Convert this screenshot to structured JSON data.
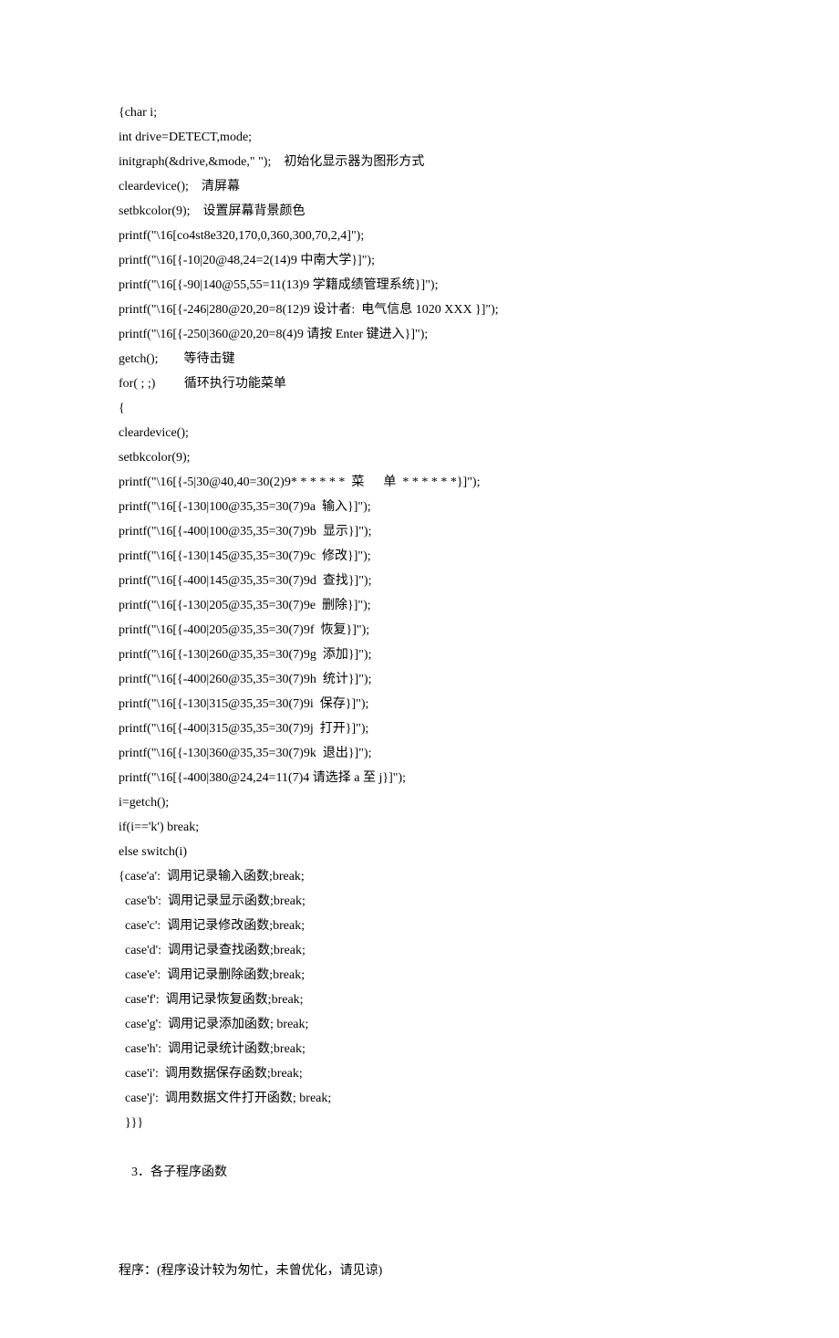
{
  "lines": [
    "{char i;",
    "int drive=DETECT,mode;",
    "initgraph(&drive,&mode,\" \");    初始化显示器为图形方式",
    "cleardevice();    清屏幕",
    "setbkcolor(9);    设置屏幕背景颜色",
    "printf(\"\\16[co4st8e320,170,0,360,300,70,2,4]\");",
    "printf(\"\\16[{-10|20@48,24=2(14)9 中南大学}]\");",
    "printf(\"\\16[{-90|140@55,55=11(13)9 学籍成绩管理系统}]\");",
    "printf(\"\\16[{-246|280@20,20=8(12)9 设计者:  电气信息 1020 XXX }]\");",
    "printf(\"\\16[{-250|360@20,20=8(4)9 请按 Enter 键进入}]\");",
    "getch();        等待击键",
    "for( ; ;)         循环执行功能菜单",
    "{",
    "cleardevice();",
    "setbkcolor(9);",
    "printf(\"\\16[{-5|30@40,40=30(2)9* * * * * *  菜      单  * * * * * *}]\");",
    "printf(\"\\16[{-130|100@35,35=30(7)9a  输入}]\");",
    "printf(\"\\16[{-400|100@35,35=30(7)9b  显示}]\");",
    "printf(\"\\16[{-130|145@35,35=30(7)9c  修改}]\");",
    "printf(\"\\16[{-400|145@35,35=30(7)9d  查找}]\");",
    "printf(\"\\16[{-130|205@35,35=30(7)9e  删除}]\");",
    "printf(\"\\16[{-400|205@35,35=30(7)9f  恢复}]\");",
    "printf(\"\\16[{-130|260@35,35=30(7)9g  添加}]\");",
    "printf(\"\\16[{-400|260@35,35=30(7)9h  统计}]\");",
    "printf(\"\\16[{-130|315@35,35=30(7)9i  保存}]\");",
    "printf(\"\\16[{-400|315@35,35=30(7)9j  打开}]\");",
    "printf(\"\\16[{-130|360@35,35=30(7)9k  退出}]\");",
    "printf(\"\\16[{-400|380@24,24=11(7)4 请选择 a 至 j}]\");",
    "i=getch();",
    "if(i=='k') break;",
    "else switch(i)",
    "{case'a':  调用记录输入函数;break;",
    "  case'b':  调用记录显示函数;break;",
    "  case'c':  调用记录修改函数;break;",
    "  case'd':  调用记录查找函数;break;",
    "  case'e':  调用记录删除函数;break;",
    "  case'f':  调用记录恢复函数;break;",
    "  case'g':  调用记录添加函数; break;",
    "  case'h':  调用记录统计函数;break;",
    "  case'i':  调用数据保存函数;break;",
    "  case'j':  调用数据文件打开函数; break;",
    "  }}}"
  ],
  "section_num": "3．",
  "section_title": "各子程序函数",
  "footer_line": "程序：(程序设计较为匆忙，未曾优化，请见谅)"
}
